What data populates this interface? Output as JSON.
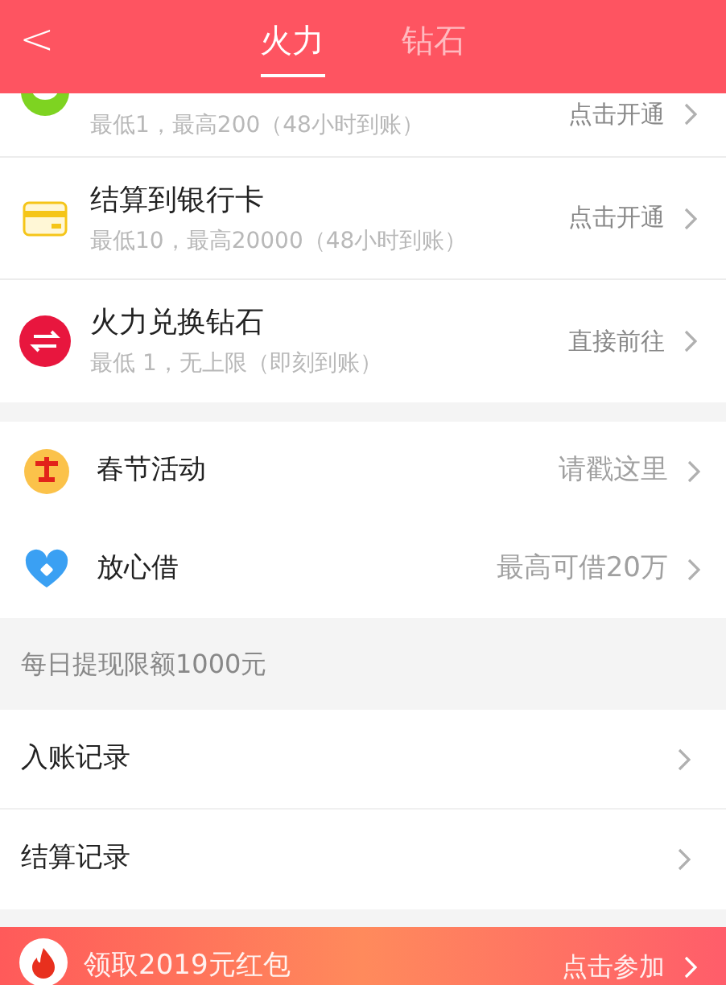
{
  "header": {
    "back": "<",
    "tabs": [
      {
        "label": "火力",
        "selected": true
      },
      {
        "label": "钻石",
        "selected": false
      }
    ]
  },
  "withdraw_options": [
    {
      "subtitle": "最低1，最高200（48小时到账）",
      "action": "点击开通"
    },
    {
      "title": "结算到银行卡",
      "subtitle": "最低10，最高20000（48小时到账）",
      "action": "点击开通"
    },
    {
      "title": "火力兑换钻石",
      "subtitle": "最低 1，无上限（即刻到账）",
      "action": "直接前往"
    }
  ],
  "promotions": [
    {
      "title": "春节活动",
      "action": "请戳这里"
    },
    {
      "title": "放心借",
      "action": "最高可借20万"
    }
  ],
  "limit_note": "每日提现限额1000元",
  "records": [
    {
      "title": "入账记录"
    },
    {
      "title": "结算记录"
    }
  ],
  "banner": {
    "text": "领取2019元红包",
    "action": "点击参加"
  }
}
